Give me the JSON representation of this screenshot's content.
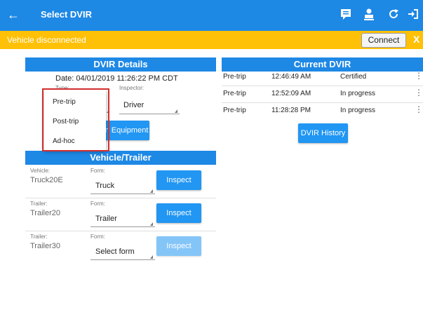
{
  "appbar": {
    "title": "Select DVIR",
    "back_icon": "arrow-left-icon",
    "icons": [
      "message-icon",
      "person-download-icon",
      "refresh-icon",
      "logout-icon"
    ]
  },
  "banner": {
    "message": "Vehicle disconnected",
    "connect_label": "Connect",
    "close_label": "X",
    "color": "#ffc107"
  },
  "dvir_details": {
    "header": "DVIR Details",
    "date_label": "Date: 04/01/2019 11:26:22 PM CDT",
    "type_label": "Type:",
    "inspector_label": "Inspector:",
    "inspector_value": "Driver",
    "equipment_button": "n Equipment",
    "type_options": [
      "Pre-trip",
      "Post-trip",
      "Ad-hoc"
    ]
  },
  "vehicle_trailer": {
    "header": "Vehicle/Trailer",
    "rows": [
      {
        "label": "Vehicle:",
        "name": "Truck20E",
        "form_label": "Form:",
        "form_value": "Truck",
        "button": "Inspect"
      },
      {
        "label": "Trailer:",
        "name": "Trailer20",
        "form_label": "Form:",
        "form_value": "Trailer",
        "button": "Inspect"
      },
      {
        "label": "Trailer:",
        "name": "Trailer30",
        "form_label": "Form:",
        "form_value": "Select form",
        "button": "Inspect"
      }
    ]
  },
  "current_dvir": {
    "header": "Current DVIR",
    "rows": [
      {
        "type": "Pre-trip",
        "time": "12:46:49 AM",
        "status": "Certified"
      },
      {
        "type": "Pre-trip",
        "time": "12:52:09 AM",
        "status": "In progress"
      },
      {
        "type": "Pre-trip",
        "time": "11:28:28 PM",
        "status": "In progress"
      }
    ],
    "history_button": "DVIR History"
  },
  "colors": {
    "primary": "#1e88e5",
    "button": "#2196f3",
    "highlight": "#d32f2f"
  }
}
